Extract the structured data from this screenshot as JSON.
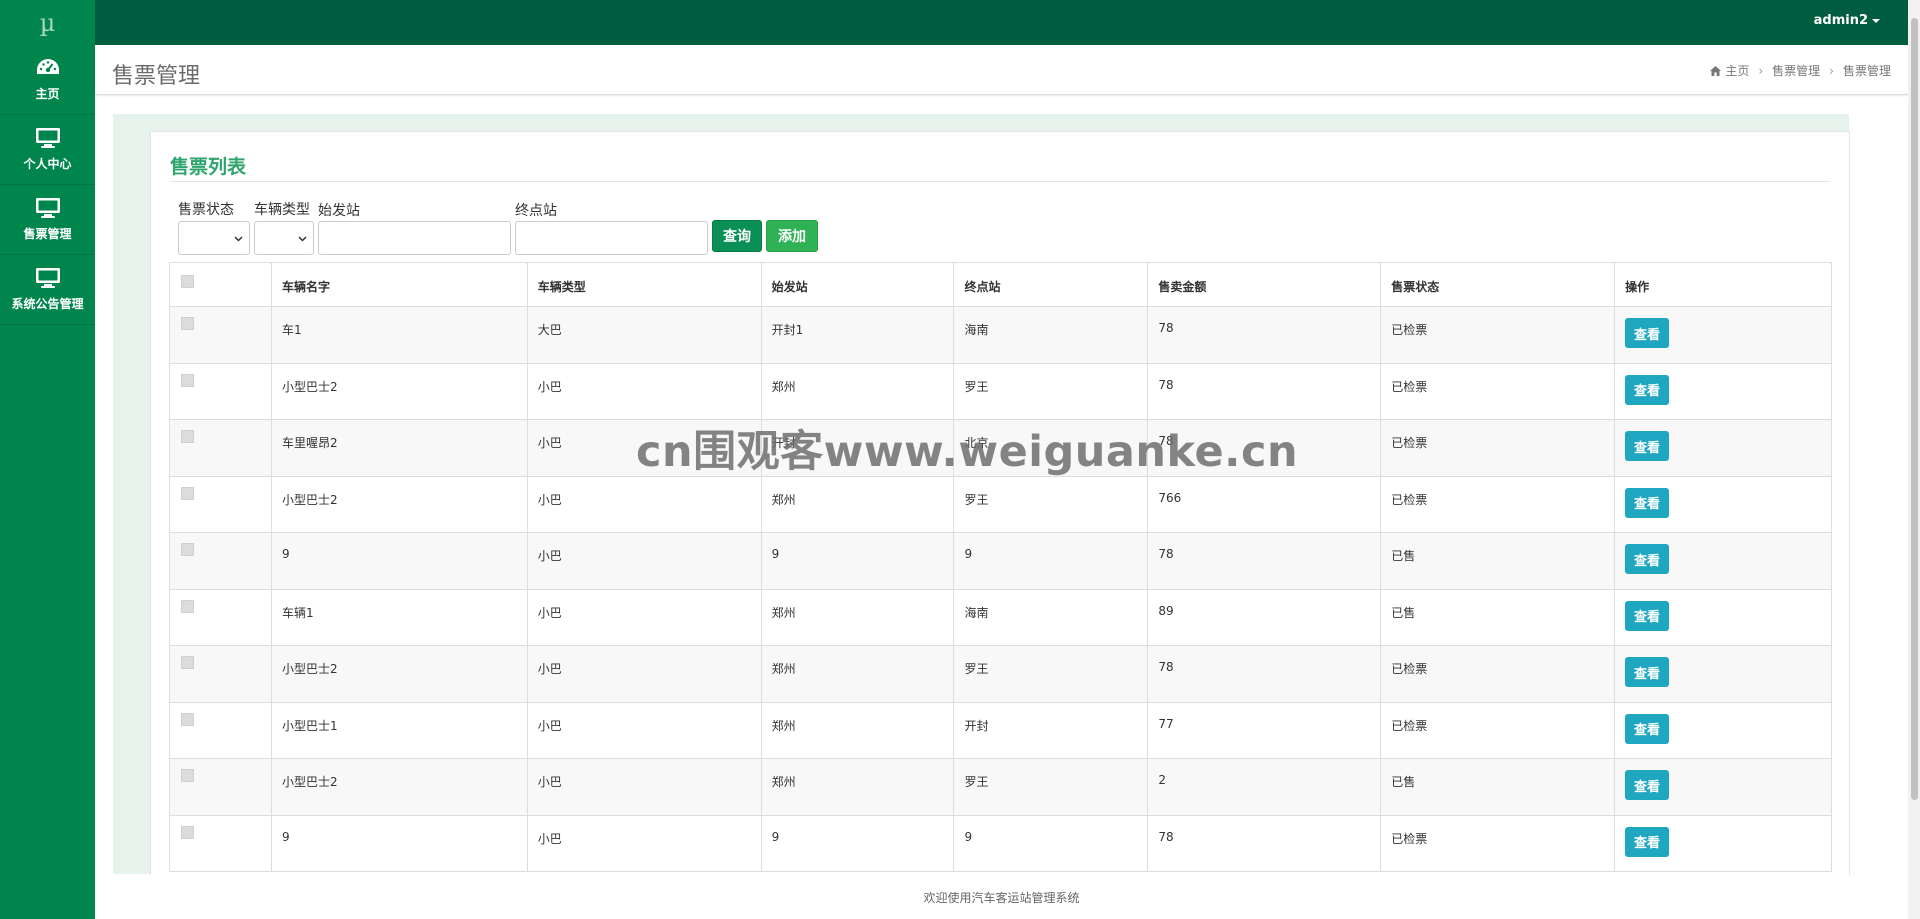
{
  "app": {
    "logo": "µ"
  },
  "sidebar": {
    "items": [
      {
        "label": "主页",
        "icon": "dashboard-icon"
      },
      {
        "label": "个人中心",
        "icon": "monitor-icon"
      },
      {
        "label": "售票管理",
        "icon": "monitor-icon"
      },
      {
        "label": "系统公告管理",
        "icon": "monitor-icon"
      }
    ]
  },
  "topbar": {
    "user": "admin2"
  },
  "header": {
    "title": "售票管理",
    "breadcrumb": [
      "主页",
      "售票管理",
      "售票管理"
    ]
  },
  "card": {
    "title": "售票列表"
  },
  "filters": {
    "status_label": "售票状态",
    "vehicle_type_label": "车辆类型",
    "start_label": "始发站",
    "end_label": "终点站",
    "start_value": "",
    "end_value": "",
    "query_button": "查询",
    "add_button": "添加"
  },
  "table": {
    "columns": [
      "车辆名字",
      "车辆类型",
      "始发站",
      "终点站",
      "售卖金额",
      "售票状态",
      "操作"
    ],
    "action_label": "查看",
    "rows": [
      [
        "车1",
        "大巴",
        "开封1",
        "海南",
        "78",
        "已检票"
      ],
      [
        "小型巴士2",
        "小巴",
        "郑州",
        "罗王",
        "78",
        "已检票"
      ],
      [
        "车里喔昂2",
        "小巴",
        "开封",
        "北京",
        "78",
        "已检票"
      ],
      [
        "小型巴士2",
        "小巴",
        "郑州",
        "罗王",
        "766",
        "已检票"
      ],
      [
        "9",
        "小巴",
        "9",
        "9",
        "78",
        "已售"
      ],
      [
        "车辆1",
        "小巴",
        "郑州",
        "海南",
        "89",
        "已售"
      ],
      [
        "小型巴士2",
        "小巴",
        "郑州",
        "罗王",
        "78",
        "已检票"
      ],
      [
        "小型巴士1",
        "小巴",
        "郑州",
        "开封",
        "77",
        "已检票"
      ],
      [
        "小型巴士2",
        "小巴",
        "郑州",
        "罗王",
        "2",
        "已售"
      ],
      [
        "9",
        "小巴",
        "9",
        "9",
        "78",
        "已检票"
      ]
    ]
  },
  "watermark": "cn围观客www.weiguanke.cn",
  "footer": {
    "text": "欢迎使用汽车客运站管理系统"
  },
  "colors": {
    "sidebar": "#00854d",
    "topbar": "#005d40",
    "accent": "#2fa46b",
    "view_button": "#1fa6c0"
  }
}
